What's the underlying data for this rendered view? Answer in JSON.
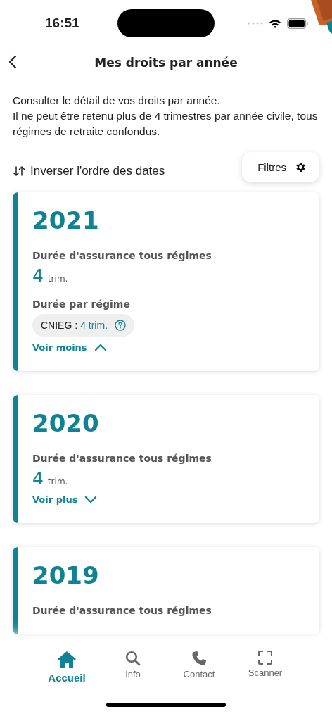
{
  "status_bar": {
    "time": "16:51"
  },
  "header": {
    "title": "Mes droits par année"
  },
  "intro": [
    "Consulter le détail de vos droits par année.",
    "Il ne peut être retenu plus de 4 trimestres par année civile, tous régimes de retraite confondus."
  ],
  "sort_toggle": {
    "label": "Inverser l'ordre des dates"
  },
  "filters_button": {
    "label": "Filtres"
  },
  "years": [
    {
      "year": "2021",
      "total_label": "Durée d'assurance tous régimes",
      "total_value": "4",
      "total_unit": "trim.",
      "expanded": true,
      "regimes_label": "Durée par régime",
      "regimes": [
        {
          "name": "CNIEG :",
          "value": "4 trim."
        }
      ],
      "toggle_label": "Voir moins"
    },
    {
      "year": "2020",
      "total_label": "Durée d'assurance tous régimes",
      "total_value": "4",
      "total_unit": "trim.",
      "expanded": false,
      "toggle_label": "Voir plus"
    },
    {
      "year": "2019",
      "total_label": "Durée d'assurance tous régimes"
    }
  ],
  "tab_bar": [
    {
      "label": "Accueil",
      "kind": "home",
      "selected": true
    },
    {
      "label": "Info",
      "kind": "search",
      "selected": false
    },
    {
      "label": "Contact",
      "kind": "phone",
      "selected": false
    },
    {
      "label": "Scanner",
      "kind": "scan",
      "selected": false
    }
  ]
}
